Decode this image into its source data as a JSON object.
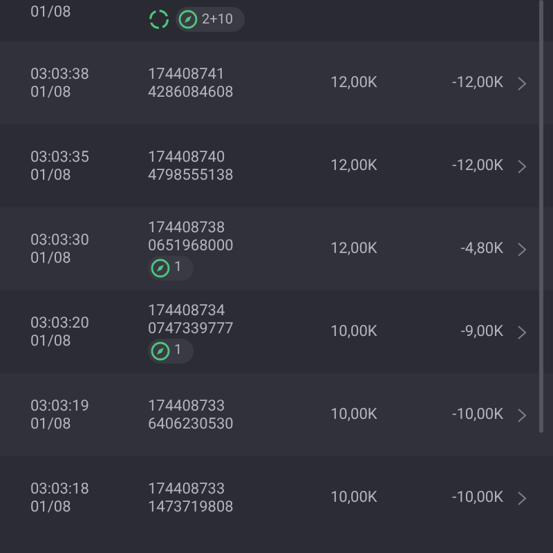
{
  "rows": [
    {
      "date": "01/08",
      "badges": [
        {
          "kind": "sync"
        },
        {
          "kind": "count",
          "text": "2+10"
        }
      ]
    },
    {
      "time": "03:03:38",
      "date": "01/08",
      "id": "174408741",
      "sub_id": "4286084608",
      "amount": "12,00K",
      "result": "-12,00K"
    },
    {
      "time": "03:03:35",
      "date": "01/08",
      "id": "174408740",
      "sub_id": "4798555138",
      "amount": "12,00K",
      "result": "-12,00K"
    },
    {
      "time": "03:03:30",
      "date": "01/08",
      "id": "174408738",
      "sub_id": "0651968000",
      "amount": "12,00K",
      "result": "-4,80K",
      "badges": [
        {
          "kind": "count",
          "text": "1"
        }
      ]
    },
    {
      "time": "03:03:20",
      "date": "01/08",
      "id": "174408734",
      "sub_id": "0747339777",
      "amount": "10,00K",
      "result": "-9,00K",
      "badges": [
        {
          "kind": "count",
          "text": "1"
        }
      ]
    },
    {
      "time": "03:03:19",
      "date": "01/08",
      "id": "174408733",
      "sub_id": "6406230530",
      "amount": "10,00K",
      "result": "-10,00K"
    },
    {
      "time": "03:03:18",
      "date": "01/08",
      "id": "174408733",
      "sub_id": "1473719808",
      "amount": "10,00K",
      "result": "-10,00K"
    }
  ]
}
